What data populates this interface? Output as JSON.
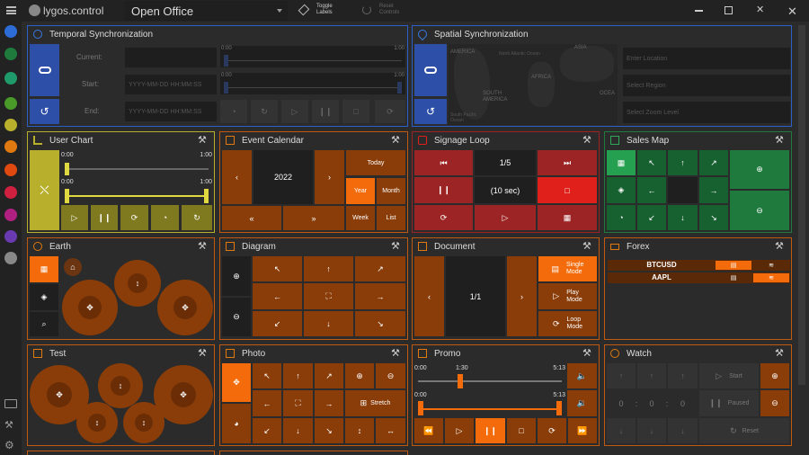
{
  "app": {
    "logo_text": "lygos.control",
    "project": "Open Office"
  },
  "toolbar": {
    "toggle_labels": "Toggle\nLabels",
    "reset_controls": "Reset\nControls"
  },
  "panels": {
    "temporal": {
      "title": "Temporal Synchronization",
      "current": "Current:",
      "start": "Start:",
      "end": "End:",
      "placeholder": "YYYY-MM-DD HH:MM:SS",
      "t0": "0:00",
      "t1": "1:00"
    },
    "spatial": {
      "title": "Spatial Synchronization",
      "loc_placeholder": "Enter Location",
      "region_placeholder": "Select Region",
      "zoom_placeholder": "Select Zoom Level",
      "map_labels": [
        "AMERICA",
        "North Atlantic Ocean",
        "AFRICA",
        "ASIA",
        "SOUTH AMERICA",
        "South Pacific Ocean",
        "OCEA"
      ]
    },
    "user_chart": {
      "title": "User Chart",
      "a0": "0:00",
      "a1": "1:00",
      "b0": "0:00",
      "b1": "1:00"
    },
    "event_calendar": {
      "title": "Event Calendar",
      "year": "2022",
      "today": "Today",
      "year_btn": "Year",
      "month": "Month",
      "week": "Week",
      "list": "List"
    },
    "signage": {
      "title": "Signage Loop",
      "page": "1/5",
      "interval": "(10 sec)"
    },
    "sales_map": {
      "title": "Sales Map"
    },
    "earth": {
      "title": "Earth"
    },
    "diagram": {
      "title": "Diagram"
    },
    "document": {
      "title": "Document",
      "page": "1/1",
      "single": "Single\nMode",
      "play": "Play\nMode",
      "loop": "Loop\nMode"
    },
    "forex": {
      "title": "Forex",
      "rows": [
        "BTCUSD",
        "AAPL"
      ]
    },
    "test": {
      "title": "Test"
    },
    "photo": {
      "title": "Photo",
      "stretch": "Stretch"
    },
    "promo": {
      "title": "Promo",
      "a0": "0:00",
      "a_mid": "1:30",
      "a1": "5:13",
      "b0": "0:00",
      "b1": "5:13"
    },
    "watch": {
      "title": "Watch",
      "start": "Start",
      "paused": "Paused",
      "reset": "Reset",
      "h": "0",
      "m": "0",
      "s": "0",
      "sep": ":"
    }
  },
  "colors": {
    "orange": "#c05a10",
    "orange_bright": "#f36b0b",
    "green": "#1f7a3e",
    "red": "#9c2424",
    "yellow": "#b8b02c",
    "blue": "#2d4fa8"
  },
  "progress": {
    "user_chart_a": 0.0,
    "user_chart_b": 0.0,
    "promo_a": 0.29,
    "promo_b": 0.0
  }
}
